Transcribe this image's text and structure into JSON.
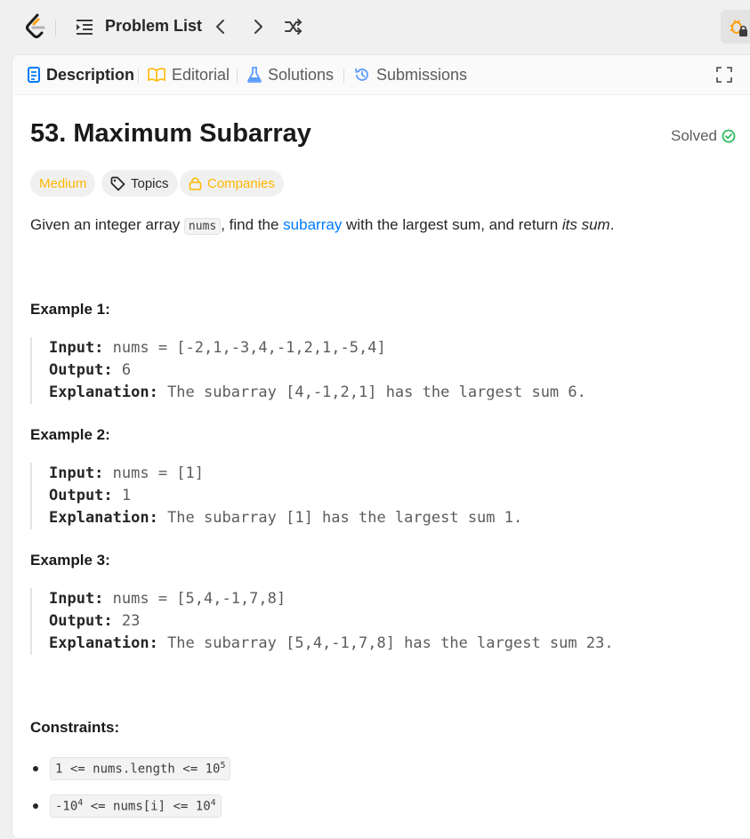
{
  "nav": {
    "problem_list_label": "Problem List"
  },
  "tabs": [
    {
      "label": "Description"
    },
    {
      "label": "Editorial"
    },
    {
      "label": "Solutions"
    },
    {
      "label": "Submissions"
    }
  ],
  "problem": {
    "title": "53. Maximum Subarray",
    "status": "Solved",
    "difficulty": "Medium",
    "topics_label": "Topics",
    "companies_label": "Companies",
    "desc_before": "Given an integer array ",
    "desc_code": "nums",
    "desc_mid": ", find the ",
    "desc_link": "subarray",
    "desc_after": " with the largest sum, and return ",
    "desc_emph": "its sum",
    "desc_end": "."
  },
  "examples": [
    {
      "title": "Example 1:",
      "input_label": "Input:",
      "input": " nums = [-2,1,-3,4,-1,2,1,-5,4]",
      "output_label": "Output:",
      "output": " 6",
      "explanation_label": "Explanation:",
      "explanation": " The subarray [4,-1,2,1] has the largest sum 6."
    },
    {
      "title": "Example 2:",
      "input_label": "Input:",
      "input": " nums = [1]",
      "output_label": "Output:",
      "output": " 1",
      "explanation_label": "Explanation:",
      "explanation": " The subarray [1] has the largest sum 1."
    },
    {
      "title": "Example 3:",
      "input_label": "Input:",
      "input": " nums = [5,4,-1,7,8]",
      "output_label": "Output:",
      "output": " 23",
      "explanation_label": "Explanation:",
      "explanation": " The subarray [5,4,-1,7,8] has the largest sum 23."
    }
  ],
  "constraints": {
    "title": "Constraints:",
    "c1_left": "1 <= nums.length <= 10",
    "c1_exp": "5",
    "c2_a": "-10",
    "c2_a_exp": "4",
    "c2_b": " <= nums[i] <= 10",
    "c2_b_exp": "4"
  },
  "colors": {
    "accent_link": "#007bff",
    "difficulty_medium": "#ffb800",
    "solved_green": "#2cbb5d"
  }
}
